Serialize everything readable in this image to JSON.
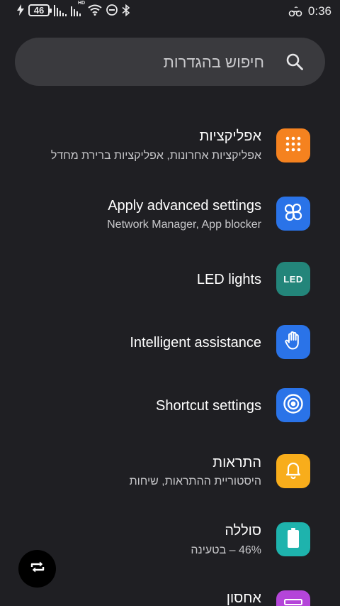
{
  "status_bar": {
    "battery_level": "46",
    "time": "0:36",
    "network_badge": "HD",
    "icons": [
      "charging-bolt-icon",
      "battery-icon",
      "signal-icon",
      "signal-hd-icon",
      "wifi-icon",
      "do-not-disturb-icon",
      "bluetooth-icon",
      "vowifi-icon"
    ]
  },
  "search": {
    "placeholder": "חיפוש בהגדרות"
  },
  "settings": [
    {
      "title": "אפליקציות",
      "subtitle": "אפליקציות אחרונות, אפליקציות ברירת מחדל",
      "icon": "apps-grid-icon",
      "color": "#f5821f"
    },
    {
      "title": "Apply advanced settings",
      "subtitle": "Network Manager, App blocker",
      "icon": "clover-icon",
      "color": "#2a73e8"
    },
    {
      "title": "LED lights",
      "icon": "led-icon",
      "icon_text": "LED",
      "color": "#23857a"
    },
    {
      "title": "Intelligent assistance",
      "icon": "hand-icon",
      "color": "#2a73e8"
    },
    {
      "title": "Shortcut settings",
      "icon": "target-icon",
      "color": "#2a73e8"
    },
    {
      "title": "התראות",
      "subtitle": "היסטוריית ההתראות, שיחות",
      "icon": "bell-icon",
      "color": "#f8ad1b"
    },
    {
      "title": "סוללה",
      "subtitle": "46% – בטעינה",
      "icon": "battery-icon",
      "color": "#1eb3ad"
    },
    {
      "title": "אחסון",
      "icon": "storage-icon",
      "color": "#b445d9"
    }
  ],
  "fab": {
    "icon": "rotate-icon"
  }
}
